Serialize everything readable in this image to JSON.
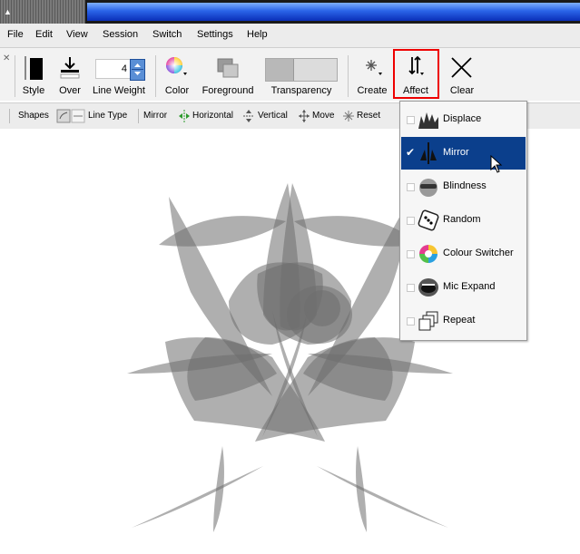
{
  "menu": [
    "File",
    "Edit",
    "View",
    "Session",
    "Switch",
    "Settings",
    "Help"
  ],
  "toolbar": {
    "style_label": "Style",
    "over_label": "Over",
    "line_weight_label": "Line Weight",
    "line_weight_value": "4",
    "color_label": "Color",
    "foreground_label": "Foreground",
    "transparency_label": "Transparency",
    "create_label": "Create",
    "affect_label": "Affect",
    "clear_label": "Clear"
  },
  "subbar": {
    "shapes": "Shapes",
    "line_type": "Line Type",
    "mirror": "Mirror",
    "horizontal": "Horizontal",
    "vertical": "Vertical",
    "move": "Move",
    "reset": "Reset"
  },
  "affect_menu": {
    "selected": "Mirror",
    "items": [
      "Displace",
      "Mirror",
      "Blindness",
      "Random",
      "Colour Switcher",
      "Mic Expand",
      "Repeat"
    ]
  },
  "colors": {
    "accent_selected": "#0b3f8c",
    "highlight": "#e00000",
    "shape_fill": "#6e6e6e"
  }
}
